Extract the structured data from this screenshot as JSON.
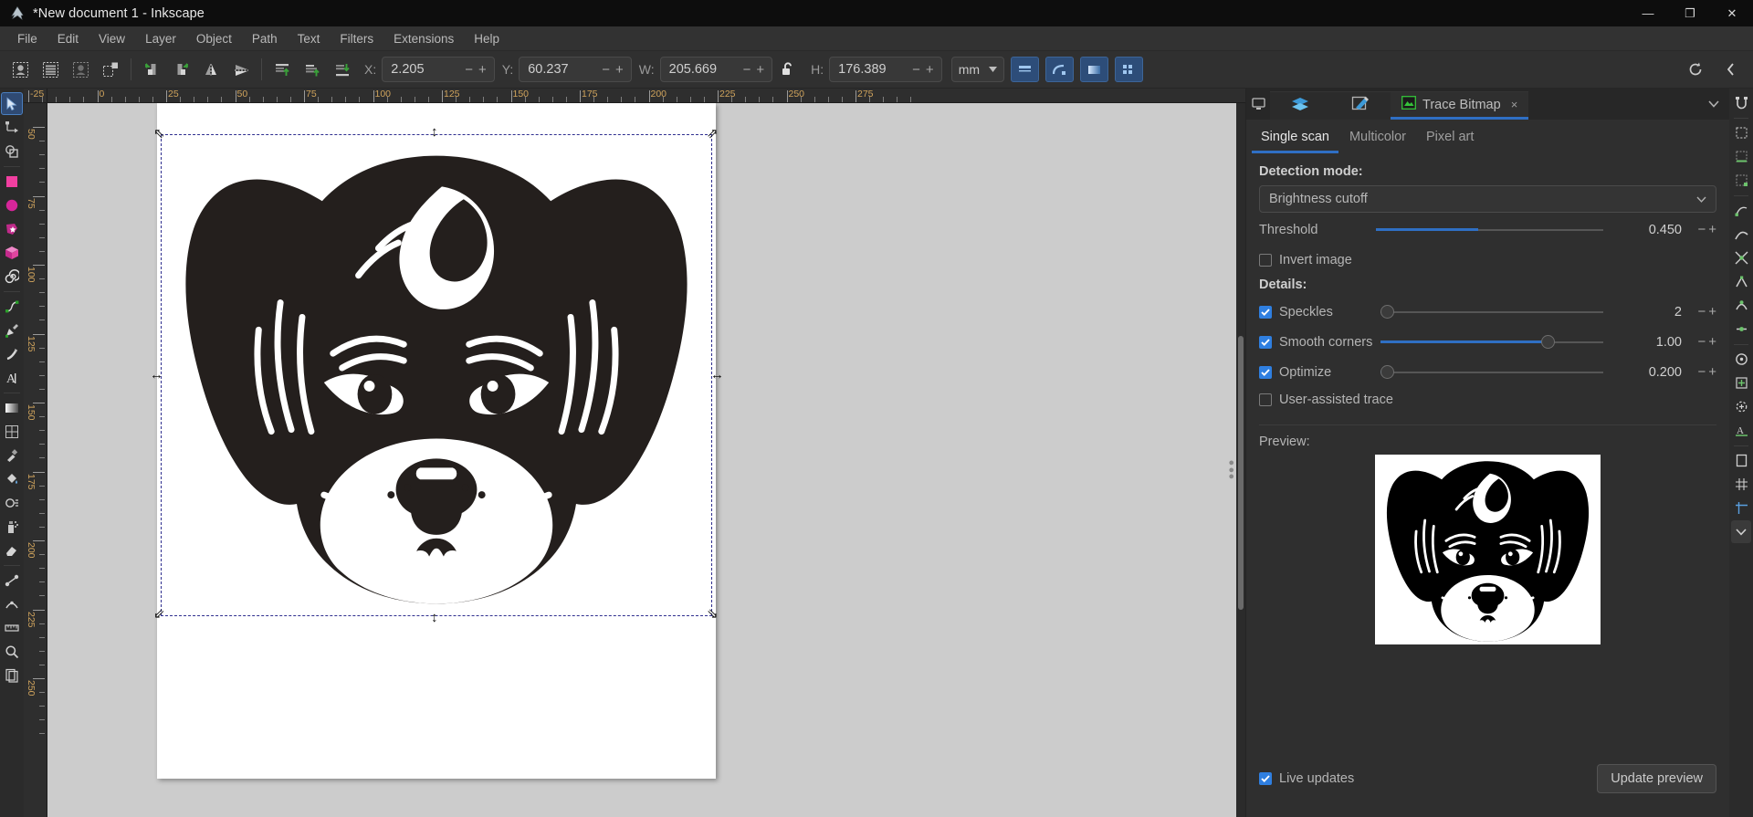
{
  "window": {
    "title": "*New document 1 - Inkscape",
    "logo_icon": "inkscape-logo-icon",
    "minimize_label": "—",
    "maximize_label": "❐",
    "close_label": "✕"
  },
  "menubar": {
    "items": [
      "File",
      "Edit",
      "View",
      "Layer",
      "Object",
      "Path",
      "Text",
      "Filters",
      "Extensions",
      "Help"
    ]
  },
  "command_toolbar": {
    "buttons": [
      {
        "name": "select-all-icon"
      },
      {
        "name": "select-all-in-layers-icon"
      },
      {
        "name": "deselect-icon"
      },
      {
        "name": "select-same-icon"
      },
      {
        "name": "rotate-ccw-icon"
      },
      {
        "name": "rotate-cw-icon"
      },
      {
        "name": "flip-horizontal-icon"
      },
      {
        "name": "flip-vertical-icon"
      },
      {
        "name": "raise-to-top-icon"
      },
      {
        "name": "raise-icon"
      },
      {
        "name": "lower-to-bottom-icon"
      }
    ],
    "fields": [
      {
        "label": "X:",
        "value": "2.205"
      },
      {
        "label": "Y:",
        "value": "60.237"
      },
      {
        "label": "W:",
        "value": "205.669"
      },
      {
        "label": "H:",
        "value": "176.389"
      }
    ],
    "lock_icon": "unlocked-padlock-icon",
    "unit": "mm",
    "unit_chevron": "chevron-down-icon",
    "minus_label": "−",
    "plus_label": "+",
    "affect_buttons": [
      {
        "name": "affect-stroke-width-icon"
      },
      {
        "name": "affect-rounded-corners-icon"
      },
      {
        "name": "affect-gradients-icon"
      },
      {
        "name": "affect-patterns-icon"
      }
    ],
    "reset_icon": "reset-transform-icon",
    "collapse_icon": "chevron-left-icon"
  },
  "toolbox": {
    "tools": [
      {
        "name": "selector-tool",
        "icon": "cursor-arrow-icon",
        "active": true
      },
      {
        "name": "node-tool",
        "icon": "node-editor-icon",
        "active": false
      },
      {
        "name": "boolean-tool",
        "icon": "boolean-ops-icon",
        "active": false
      },
      {
        "name": "rectangle-tool",
        "icon": "square-icon",
        "active": false
      },
      {
        "name": "ellipse-tool",
        "icon": "circle-icon",
        "active": false
      },
      {
        "name": "star-tool",
        "icon": "star-icon",
        "active": false
      },
      {
        "name": "3dbox-tool",
        "icon": "cube-icon",
        "active": false
      },
      {
        "name": "spiral-tool",
        "icon": "spiral-icon",
        "active": false
      },
      {
        "name": "pencil-tool",
        "icon": "pencil-path-icon",
        "active": false
      },
      {
        "name": "pen-tool",
        "icon": "bezier-pen-icon",
        "active": false
      },
      {
        "name": "calligraphy-tool",
        "icon": "calligraphy-icon",
        "active": false
      },
      {
        "name": "text-tool",
        "icon": "text-a-icon",
        "active": false
      },
      {
        "name": "gradient-tool",
        "icon": "gradient-icon",
        "active": false
      },
      {
        "name": "mesh-tool",
        "icon": "mesh-gradient-icon",
        "active": false
      },
      {
        "name": "dropper-tool",
        "icon": "eyedropper-icon",
        "active": false
      },
      {
        "name": "paintbucket-tool",
        "icon": "paint-bucket-icon",
        "active": false
      },
      {
        "name": "tweak-tool",
        "icon": "tweak-icon",
        "active": false
      },
      {
        "name": "spray-tool",
        "icon": "spray-can-icon",
        "active": false
      },
      {
        "name": "eraser-tool",
        "icon": "eraser-icon",
        "active": false
      },
      {
        "name": "connector-tool",
        "icon": "connector-icon",
        "active": false
      },
      {
        "name": "lpe-tool",
        "icon": "lpe-icon",
        "active": false
      },
      {
        "name": "measure-tool",
        "icon": "ruler-measure-icon",
        "active": false
      },
      {
        "name": "zoom-tool",
        "icon": "magnifier-icon",
        "active": false
      },
      {
        "name": "pages-tool",
        "icon": "pages-icon",
        "active": false
      }
    ]
  },
  "rulers": {
    "horizontal_labels": [
      "-25",
      "0",
      "25",
      "50",
      "75",
      "100",
      "125",
      "150",
      "175",
      "200",
      "225",
      "250",
      "275"
    ],
    "vertical_labels": [
      "50",
      "75",
      "100",
      "125",
      "150",
      "175",
      "200",
      "225",
      "250"
    ]
  },
  "canvas": {
    "artwork_name": "dog-head-silhouette",
    "selection_handles": "scale-arrows"
  },
  "panel": {
    "dock_tabs": [
      {
        "name": "layers-tab",
        "icon": "layers-icon",
        "label": "",
        "active": false
      },
      {
        "name": "fill-stroke-tab",
        "icon": "fill-stroke-icon",
        "label": "",
        "active": false
      },
      {
        "name": "trace-bitmap-tab",
        "icon": "trace-bitmap-icon",
        "label": "Trace Bitmap",
        "active": true,
        "close": "×"
      }
    ],
    "chevron_icon": "chevron-down-icon",
    "subtabs": [
      {
        "label": "Single scan",
        "active": true
      },
      {
        "label": "Multicolor",
        "active": false
      },
      {
        "label": "Pixel art",
        "active": false
      }
    ],
    "detection_mode": {
      "title": "Detection mode:",
      "value": "Brightness cutoff",
      "chevron": "chevron-down-icon"
    },
    "threshold": {
      "label": "Threshold",
      "value": "0.450",
      "fill_pct": 45,
      "minus": "−",
      "plus": "+"
    },
    "invert_image": {
      "label": "Invert image",
      "checked": false
    },
    "details_title": "Details:",
    "details": [
      {
        "label": "Speckles",
        "checked": true,
        "value": "2",
        "fill_pct": 0,
        "minus": "−",
        "plus": "+"
      },
      {
        "label": "Smooth corners",
        "checked": true,
        "value": "1.00",
        "fill_pct": 75,
        "minus": "−",
        "plus": "+"
      },
      {
        "label": "Optimize",
        "checked": true,
        "value": "0.200",
        "fill_pct": 2,
        "minus": "−",
        "plus": "+"
      }
    ],
    "user_assisted": {
      "label": "User-assisted trace",
      "checked": false
    },
    "preview_label": "Preview:",
    "preview_image_name": "dog-head-trace-preview",
    "live_updates": {
      "label": "Live updates",
      "checked": true
    },
    "update_preview_button": "Update preview"
  },
  "snap_dock": {
    "items": [
      {
        "name": "snap-toggle-icon"
      },
      {
        "name": "snap-bounding-box-icon"
      },
      {
        "name": "snap-bbox-edge-icon"
      },
      {
        "name": "snap-bbox-corner-icon"
      },
      {
        "name": "snap-nodes-icon"
      },
      {
        "name": "snap-paths-icon"
      },
      {
        "name": "snap-path-intersection-icon"
      },
      {
        "name": "snap-cusp-nodes-icon"
      },
      {
        "name": "snap-smooth-nodes-icon"
      },
      {
        "name": "snap-midpoints-icon"
      },
      {
        "name": "snap-others-icon"
      },
      {
        "name": "snap-object-center-icon"
      },
      {
        "name": "snap-rotation-center-icon"
      },
      {
        "name": "snap-text-baseline-icon"
      },
      {
        "name": "snap-page-border-icon"
      },
      {
        "name": "snap-grid-icon"
      },
      {
        "name": "snap-guides-icon"
      },
      {
        "name": "snap-more-icon"
      }
    ],
    "chevron_icon": "chevron-down-icon"
  },
  "colors": {
    "accent": "#2f6fc4",
    "titlebar_bg": "#0d0d0d",
    "panel_bg": "#2f2f2f",
    "canvas_bg": "#cccccc",
    "checkbox_on": "#2f7fe0"
  }
}
